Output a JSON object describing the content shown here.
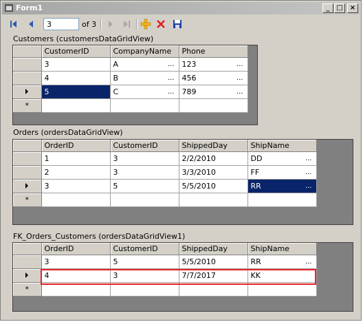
{
  "window": {
    "title": "Form1"
  },
  "navigator": {
    "position": "3",
    "count_label": "of 3"
  },
  "customers": {
    "label": "Customers (customersDataGridView)",
    "columns": [
      "CustomerID",
      "CompanyName",
      "Phone"
    ],
    "rows": [
      [
        "3",
        "A",
        "123"
      ],
      [
        "4",
        "B",
        "456"
      ],
      [
        "5",
        "C",
        "789"
      ]
    ]
  },
  "orders": {
    "label": "Orders (ordersDataGridView)",
    "columns": [
      "OrderID",
      "CustomerID",
      "ShippedDay",
      "ShipName"
    ],
    "rows": [
      [
        "1",
        "3",
        "2/2/2010",
        "DD"
      ],
      [
        "2",
        "3",
        "3/3/2010",
        "FF"
      ],
      [
        "3",
        "5",
        "5/5/2010",
        "RR"
      ]
    ]
  },
  "fk_orders": {
    "label": "FK_Orders_Customers (ordersDataGridView1)",
    "columns": [
      "OrderID",
      "CustomerID",
      "ShippedDay",
      "ShipName"
    ],
    "rows": [
      [
        "3",
        "5",
        "5/5/2010",
        "RR"
      ],
      [
        "4",
        "3",
        "7/7/2017",
        "KK"
      ]
    ]
  },
  "colors": {
    "selection": "#0a246a",
    "highlight_border": "#e8202a",
    "window_face": "#d4d0c8"
  }
}
